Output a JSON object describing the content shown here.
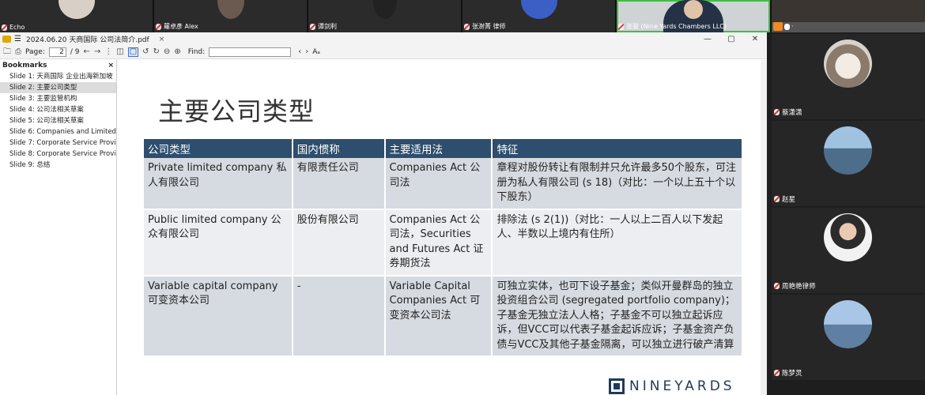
{
  "participants_top": [
    {
      "name": "Echo",
      "muted": true
    },
    {
      "name": "蘿卓彥 Alex",
      "muted": true
    },
    {
      "name": "谭剑利",
      "muted": true
    },
    {
      "name": "张澍菁 律师",
      "muted": true
    },
    {
      "name": "张骏 (Nine Yards Chambers LLC)",
      "muted": false,
      "active": true
    }
  ],
  "top_right_label": "·",
  "pdf": {
    "tab_title": "2024.06.20 天商国际 公司法简介.pdf",
    "tab_close": "×",
    "window_controls": [
      "—",
      "▢",
      "✕"
    ],
    "toolbar": {
      "page_label": "Page:",
      "page_current": "2",
      "page_total": "/ 9",
      "find_label": "Find:",
      "find_value": "",
      "case_toggle": "Aₐ"
    },
    "bookmarks": {
      "title": "Bookmarks",
      "close": "×",
      "items": [
        "Slide 1: 天商国际 企业出海新加坡",
        "Slide 2: 主要公司类型",
        "Slide 3: 主要监管机构",
        "Slide 4: 公司法相关草案",
        "Slide 5: 公司法相关草案",
        "Slide 6: Companies and Limited L",
        "Slide 7: Corporate Service Provide",
        "Slide 8: Corporate Service Provide",
        "Slide 9: 总结"
      ],
      "selected_index": 1
    },
    "slide": {
      "title": "主要公司类型",
      "headers": [
        "公司类型",
        "国内惯称",
        "主要适用法",
        "特征"
      ],
      "rows": [
        [
          "Private limited company 私人有限公司",
          "有限责任公司",
          "Companies Act 公司法",
          "章程对股份转让有限制并只允许最多50个股东，可注册为私人有限公司 (s 18)（对比：一个以上五十个以下股东）"
        ],
        [
          "Public limited company 公众有限公司",
          "股份有限公司",
          "Companies Act 公司法，Securities and Futures Act 证券期货法",
          "排除法 (s 2(1))（对比：一人以上二百人以下发起人、半数以上境内有住所）"
        ],
        [
          "Variable capital company 可变资本公司",
          "-",
          "Variable Capital Companies Act 可变资本公司法",
          "可独立实体，也可下设子基金；类似开曼群岛的独立投资组合公司 (segregated portfolio company)；子基金无独立法人人格；子基金不可以独立起诉应诉，但VCC可以代表子基金起诉应诉；子基金资产负债与VCC及其他子基金隔离，可以独立进行破产清算"
        ]
      ],
      "brand": "NINEYARDS"
    }
  },
  "participants_right": [
    {
      "name": "蔡潇潇",
      "muted": true
    },
    {
      "name": "赵星",
      "muted": true
    },
    {
      "name": "周艳艳律师",
      "muted": true
    },
    {
      "name": "陈梦灵",
      "muted": true
    }
  ]
}
